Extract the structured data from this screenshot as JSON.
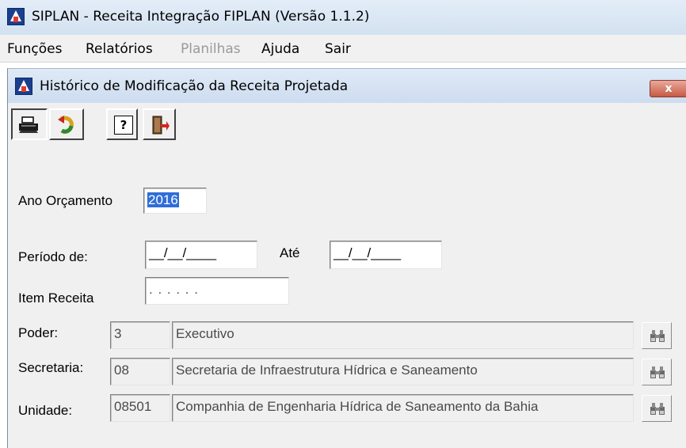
{
  "app": {
    "title": "SIPLAN - Receita Integração FIPLAN (Versão 1.1.2)"
  },
  "menu": [
    {
      "label": "Funções",
      "disabled": false
    },
    {
      "label": "Relatórios",
      "disabled": false
    },
    {
      "label": "Planilhas",
      "disabled": true
    },
    {
      "label": "Ajuda",
      "disabled": false
    },
    {
      "label": "Sair",
      "disabled": false
    }
  ],
  "window": {
    "title": "Histórico de Modificação da Receita Projetada",
    "close_label": "x"
  },
  "toolbar": {
    "help_label": "?"
  },
  "form": {
    "ano_label": "Ano Orçamento",
    "ano_value": "2016",
    "periodo_label": "Período de:",
    "periodo_de_value": "__/__/____",
    "ate_label": "Até",
    "periodo_ate_value": "__/__/____",
    "item_label": "Item Receita",
    "item_value": ". . . . . .",
    "poder_label": "Poder:",
    "poder_code": "3",
    "poder_name": "Executivo",
    "secretaria_label": "Secretaria:",
    "secretaria_code": "08",
    "secretaria_name": "Secretaria de Infraestrutura Hídrica e Saneamento",
    "unidade_label": "Unidade:",
    "unidade_code": "08501",
    "unidade_name": "Companhia de Engenharia Hídrica de Saneamento da Bahia"
  }
}
